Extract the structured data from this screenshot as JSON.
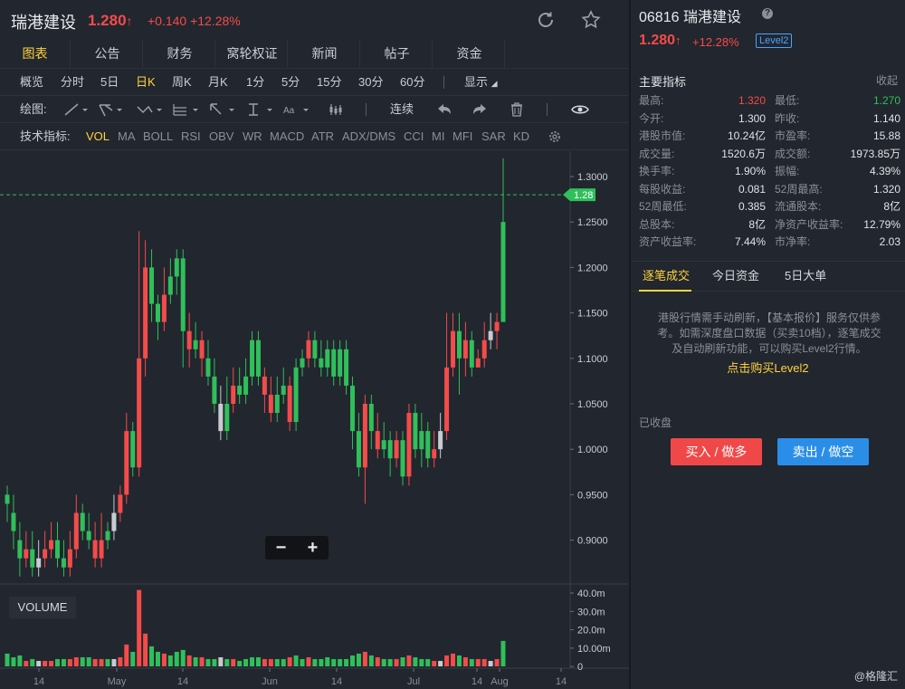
{
  "header": {
    "name": "瑞港建设",
    "price": "1.280",
    "price_arrow": "↑",
    "change": "+0.140 +12.28%"
  },
  "tabs": [
    "图表",
    "公告",
    "财务",
    "窝轮权证",
    "新闻",
    "帖子",
    "资金"
  ],
  "periods": [
    "概览",
    "分时",
    "5日",
    "日K",
    "周K",
    "月K",
    "1分",
    "5分",
    "15分",
    "30分",
    "60分"
  ],
  "display_label": "显示",
  "draw_label": "绘图:",
  "draw_continuous": "连续",
  "indicator_label": "技术指标:",
  "indicators": [
    "VOL",
    "MA",
    "BOLL",
    "RSI",
    "OBV",
    "WR",
    "MACD",
    "ATR",
    "ADX/DMS",
    "CCI",
    "MI",
    "MFI",
    "SAR",
    "KD"
  ],
  "zoom": {
    "minus": "−",
    "plus": "+"
  },
  "volume_label": "VOLUME",
  "chart_data": {
    "type": "candlestick",
    "price_axis": {
      "ticks": [
        "1.3000",
        "1.2500",
        "1.2000",
        "1.1500",
        "1.1000",
        "1.0500",
        "1.0000",
        "0.9500",
        "0.9000"
      ]
    },
    "volume_axis": {
      "ticks": [
        "40.0m",
        "30.0m",
        "20.0m",
        "10.00m",
        "0"
      ]
    },
    "x_ticks": [
      "14",
      "May",
      "14",
      "Jun",
      "14",
      "Jul",
      "14",
      "Aug",
      "14"
    ],
    "last_price_label": "1.28",
    "last_price": 1.28,
    "up_color": "#2fbf5b",
    "down_color": "#f44b4b",
    "candles": [
      [
        0.95,
        0.94,
        0.96,
        0.92,
        7,
        "g"
      ],
      [
        0.93,
        0.91,
        0.95,
        0.89,
        5,
        "g"
      ],
      [
        0.9,
        0.88,
        0.92,
        0.86,
        6,
        "g"
      ],
      [
        0.88,
        0.89,
        0.91,
        0.87,
        3,
        "r"
      ],
      [
        0.89,
        0.87,
        0.91,
        0.86,
        4,
        "g"
      ],
      [
        0.87,
        0.88,
        0.9,
        0.86,
        3,
        "w"
      ],
      [
        0.88,
        0.89,
        0.91,
        0.87,
        3,
        "r"
      ],
      [
        0.89,
        0.9,
        0.92,
        0.88,
        3,
        "r"
      ],
      [
        0.9,
        0.88,
        0.92,
        0.87,
        4,
        "g"
      ],
      [
        0.88,
        0.87,
        0.9,
        0.86,
        4,
        "g"
      ],
      [
        0.87,
        0.89,
        0.91,
        0.86,
        4,
        "r"
      ],
      [
        0.89,
        0.93,
        0.95,
        0.88,
        5,
        "r"
      ],
      [
        0.93,
        0.91,
        0.94,
        0.9,
        5,
        "g"
      ],
      [
        0.91,
        0.9,
        0.93,
        0.89,
        5,
        "g"
      ],
      [
        0.9,
        0.88,
        0.92,
        0.87,
        4,
        "r"
      ],
      [
        0.88,
        0.9,
        0.93,
        0.87,
        4,
        "r"
      ],
      [
        0.9,
        0.91,
        0.92,
        0.89,
        4,
        "g"
      ],
      [
        0.91,
        0.93,
        0.95,
        0.9,
        4,
        "w"
      ],
      [
        0.93,
        0.95,
        0.96,
        0.92,
        5,
        "r"
      ],
      [
        0.95,
        1.02,
        1.04,
        0.94,
        12,
        "r"
      ],
      [
        1.02,
        0.98,
        1.03,
        0.97,
        8,
        "g"
      ],
      [
        0.98,
        1.1,
        1.24,
        0.97,
        42,
        "r"
      ],
      [
        1.1,
        1.2,
        1.23,
        1.08,
        18,
        "r"
      ],
      [
        1.2,
        1.16,
        1.22,
        1.14,
        11,
        "g"
      ],
      [
        1.16,
        1.14,
        1.17,
        1.12,
        8,
        "g"
      ],
      [
        1.14,
        1.17,
        1.2,
        1.13,
        7,
        "r"
      ],
      [
        1.17,
        1.19,
        1.21,
        1.16,
        6,
        "g"
      ],
      [
        1.19,
        1.21,
        1.22,
        1.17,
        8,
        "g"
      ],
      [
        1.21,
        1.13,
        1.22,
        1.09,
        9,
        "g"
      ],
      [
        1.13,
        1.11,
        1.15,
        1.09,
        6,
        "r"
      ],
      [
        1.11,
        1.12,
        1.14,
        1.1,
        5,
        "g"
      ],
      [
        1.12,
        1.1,
        1.13,
        1.08,
        5,
        "r"
      ],
      [
        1.1,
        1.08,
        1.12,
        1.07,
        4,
        "g"
      ],
      [
        1.08,
        1.05,
        1.1,
        1.04,
        4,
        "g"
      ],
      [
        1.05,
        1.02,
        1.07,
        1.01,
        5,
        "w"
      ],
      [
        1.02,
        1.05,
        1.08,
        1.01,
        4,
        "g"
      ],
      [
        1.05,
        1.07,
        1.09,
        1.04,
        4,
        "r"
      ],
      [
        1.07,
        1.06,
        1.09,
        1.05,
        3,
        "g"
      ],
      [
        1.06,
        1.08,
        1.1,
        1.05,
        4,
        "g"
      ],
      [
        1.08,
        1.12,
        1.13,
        1.07,
        5,
        "g"
      ],
      [
        1.12,
        1.08,
        1.13,
        1.07,
        5,
        "g"
      ],
      [
        1.08,
        1.06,
        1.09,
        1.04,
        4,
        "r"
      ],
      [
        1.06,
        1.04,
        1.08,
        1.03,
        4,
        "r"
      ],
      [
        1.04,
        1.06,
        1.08,
        1.03,
        4,
        "g"
      ],
      [
        1.06,
        1.07,
        1.09,
        1.05,
        4,
        "g"
      ],
      [
        1.07,
        1.03,
        1.08,
        1.02,
        5,
        "r"
      ],
      [
        1.03,
        1.09,
        1.1,
        1.02,
        6,
        "g"
      ],
      [
        1.09,
        1.1,
        1.11,
        1.08,
        4,
        "g"
      ],
      [
        1.1,
        1.12,
        1.13,
        1.09,
        5,
        "r"
      ],
      [
        1.12,
        1.1,
        1.13,
        1.09,
        4,
        "g"
      ],
      [
        1.1,
        1.09,
        1.12,
        1.08,
        4,
        "g"
      ],
      [
        1.09,
        1.11,
        1.12,
        1.08,
        5,
        "g"
      ],
      [
        1.11,
        1.08,
        1.12,
        1.07,
        4,
        "g"
      ],
      [
        1.08,
        1.11,
        1.12,
        1.07,
        4,
        "g"
      ],
      [
        1.11,
        1.07,
        1.12,
        1.06,
        4,
        "g"
      ],
      [
        1.07,
        1.02,
        1.08,
        1.0,
        6,
        "g"
      ],
      [
        1.02,
        0.98,
        1.04,
        0.97,
        7,
        "g"
      ],
      [
        0.98,
        1.05,
        1.06,
        0.94,
        8,
        "r"
      ],
      [
        1.05,
        1.02,
        1.06,
        1.0,
        6,
        "g"
      ],
      [
        1.02,
        1.0,
        1.04,
        0.99,
        5,
        "r"
      ],
      [
        1.0,
        1.01,
        1.03,
        0.99,
        4,
        "g"
      ],
      [
        1.01,
        0.99,
        1.02,
        0.97,
        4,
        "g"
      ],
      [
        0.99,
        1.01,
        1.02,
        0.98,
        4,
        "r"
      ],
      [
        1.01,
        0.97,
        1.02,
        0.96,
        5,
        "g"
      ],
      [
        0.97,
        1.04,
        1.05,
        0.96,
        6,
        "r"
      ],
      [
        1.04,
        1.0,
        1.05,
        0.99,
        5,
        "g"
      ],
      [
        1.0,
        1.02,
        1.04,
        0.98,
        4,
        "g"
      ],
      [
        1.02,
        0.99,
        1.03,
        0.98,
        4,
        "g"
      ],
      [
        0.99,
        1.0,
        1.02,
        0.98,
        3,
        "r"
      ],
      [
        1.0,
        1.02,
        1.04,
        0.99,
        3,
        "w"
      ],
      [
        1.02,
        1.09,
        1.15,
        1.01,
        6,
        "r"
      ],
      [
        1.09,
        1.13,
        1.15,
        1.08,
        7,
        "r"
      ],
      [
        1.13,
        1.1,
        1.15,
        1.06,
        6,
        "g"
      ],
      [
        1.1,
        1.12,
        1.14,
        1.08,
        5,
        "r"
      ],
      [
        1.12,
        1.09,
        1.13,
        1.08,
        4,
        "g"
      ],
      [
        1.09,
        1.1,
        1.11,
        1.09,
        4,
        "r"
      ],
      [
        1.1,
        1.12,
        1.14,
        1.09,
        4,
        "r"
      ],
      [
        1.12,
        1.13,
        1.15,
        1.11,
        3,
        "w"
      ],
      [
        1.13,
        1.14,
        1.15,
        1.11,
        4,
        "r"
      ],
      [
        1.14,
        1.25,
        1.32,
        1.23,
        14,
        "g"
      ]
    ]
  },
  "right": {
    "code_name": "06816 瑞港建设",
    "help": "?",
    "price": "1.280",
    "price_arrow": "↑",
    "change": "+12.28%",
    "level2": "Level2",
    "section_title": "主要指标",
    "collapse": "收起",
    "indicators": [
      {
        "l1": "最高:",
        "v1": "1.320",
        "c1": "#f44b4b",
        "l2": "最低:",
        "v2": "1.270",
        "c2": "#2fbf5b"
      },
      {
        "l1": "今开:",
        "v1": "1.300",
        "c1": "#e0e2e5",
        "l2": "昨收:",
        "v2": "1.140",
        "c2": "#e0e2e5"
      },
      {
        "l1": "港股市值:",
        "v1": "10.24亿",
        "c1": "#e0e2e5",
        "l2": "市盈率:",
        "v2": "15.88",
        "c2": "#e0e2e5"
      },
      {
        "l1": "成交量:",
        "v1": "1520.6万",
        "c1": "#e0e2e5",
        "l2": "成交额:",
        "v2": "1973.85万",
        "c2": "#e0e2e5"
      },
      {
        "l1": "换手率:",
        "v1": "1.90%",
        "c1": "#e0e2e5",
        "l2": "振幅:",
        "v2": "4.39%",
        "c2": "#e0e2e5"
      },
      {
        "l1": "每股收益:",
        "v1": "0.081",
        "c1": "#e0e2e5",
        "l2": "52周最高:",
        "v2": "1.320",
        "c2": "#e0e2e5"
      },
      {
        "l1": "52周最低:",
        "v1": "0.385",
        "c1": "#e0e2e5",
        "l2": "流通股本:",
        "v2": "8亿",
        "c2": "#e0e2e5"
      },
      {
        "l1": "总股本:",
        "v1": "8亿",
        "c1": "#e0e2e5",
        "l2": "净资产收益率:",
        "v2": "12.79%",
        "c2": "#e0e2e5"
      },
      {
        "l1": "资产收益率:",
        "v1": "7.44%",
        "c1": "#e0e2e5",
        "l2": "市净率:",
        "v2": "2.03",
        "c2": "#e0e2e5"
      }
    ],
    "tabs": [
      "逐笔成交",
      "今日资金",
      "5日大单"
    ],
    "notice": "港股行情需手动刷新，【基本报价】服务仅供参考。如需深度盘口数据（买卖10档），逐笔成交及自动刷新功能，可以购买Level2行情。",
    "buy_level2": "点击购买Level2",
    "closed": "已收盘",
    "buy_button": "买入 / 做多",
    "sell_button": "卖出 / 做空",
    "buy_color": "#f04848",
    "sell_color": "#2a8ee8"
  },
  "watermark": "@格隆汇"
}
